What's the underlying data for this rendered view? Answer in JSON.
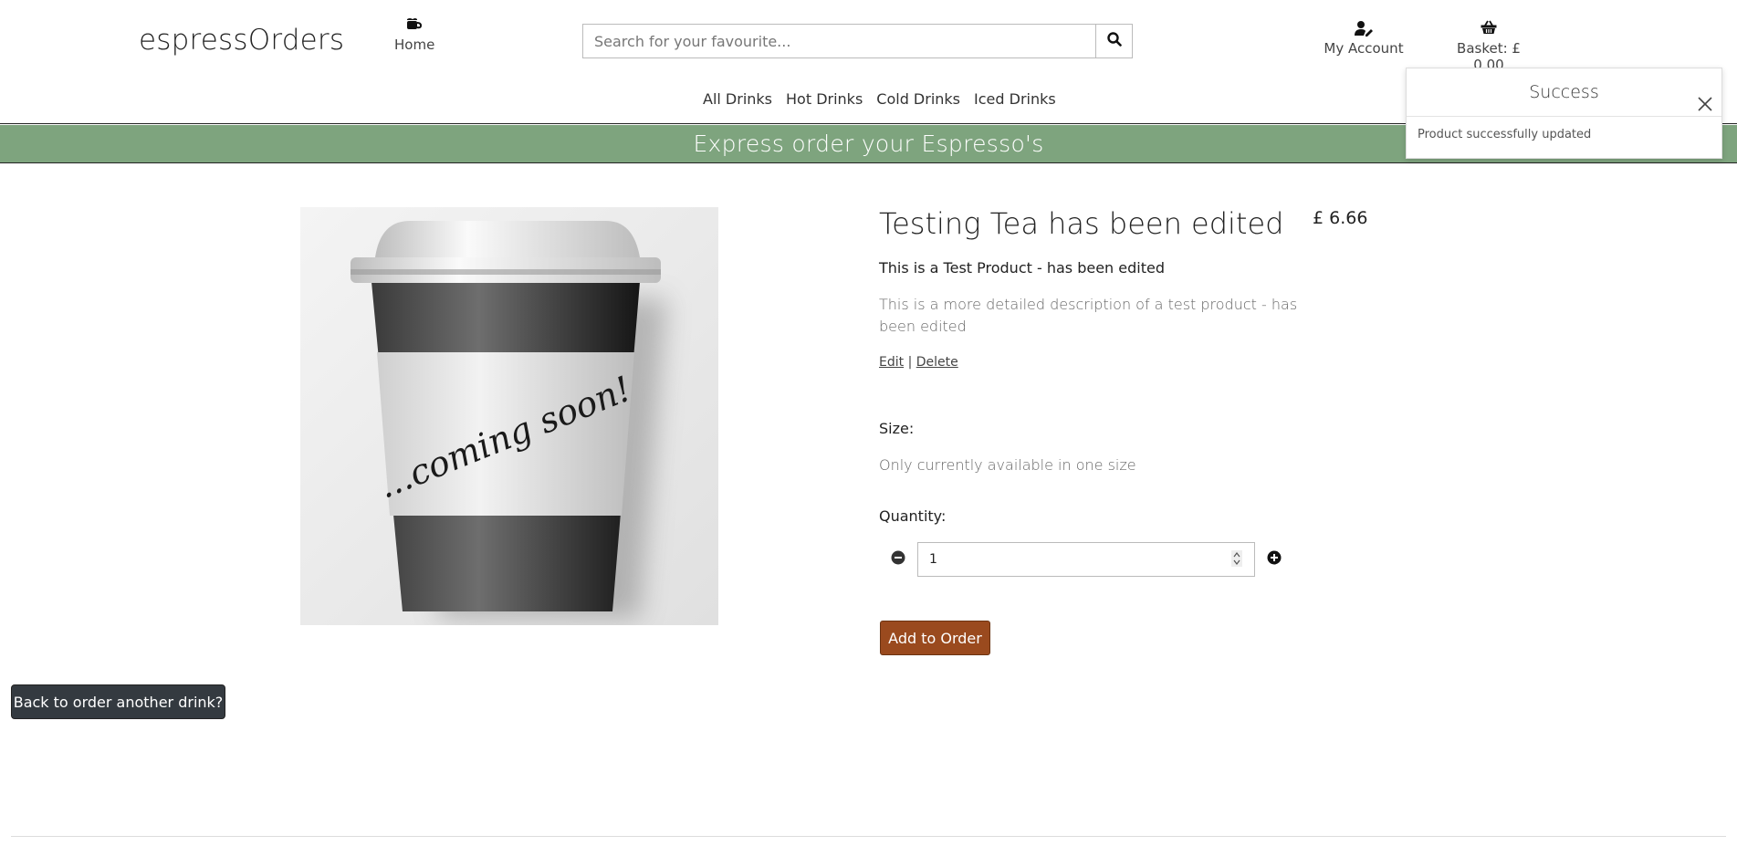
{
  "header": {
    "logo": "espressOrders",
    "home_label": "Home",
    "account_label": "My Account",
    "basket_label": "Basket: £ 0.00"
  },
  "search": {
    "placeholder": "Search for your favourite..."
  },
  "categories": [
    "All Drinks",
    "Hot Drinks",
    "Cold Drinks",
    "Iced Drinks"
  ],
  "banner": {
    "text": "Express order your Espresso's"
  },
  "toast": {
    "title": "Success",
    "message": "Product successfully updated"
  },
  "product": {
    "image_text": "...coming soon!",
    "title": "Testing Tea has been edited",
    "price": "£ 6.66",
    "short_description": "This is a Test Product - has been edited",
    "long_description": "This is a more detailed description of a test product - has been edited",
    "edit_label": "Edit",
    "separator": "|",
    "delete_label": "Delete",
    "size_label": "Size:",
    "size_text": "Only currently available in one size",
    "quantity_label": "Quantity:",
    "quantity_value": "1",
    "add_button": "Add to Order"
  },
  "back_button": "Back to order another drink?",
  "icons": {
    "home": "coffee-mug-icon",
    "search": "search-icon",
    "account": "user-edit-icon",
    "basket": "shopping-basket-icon",
    "close": "close-icon",
    "minus": "minus-circle-icon",
    "plus": "plus-circle-icon"
  },
  "colors": {
    "banner": "#7ea47e",
    "add_button": "#9a4a1e",
    "back_button": "#343a40"
  }
}
